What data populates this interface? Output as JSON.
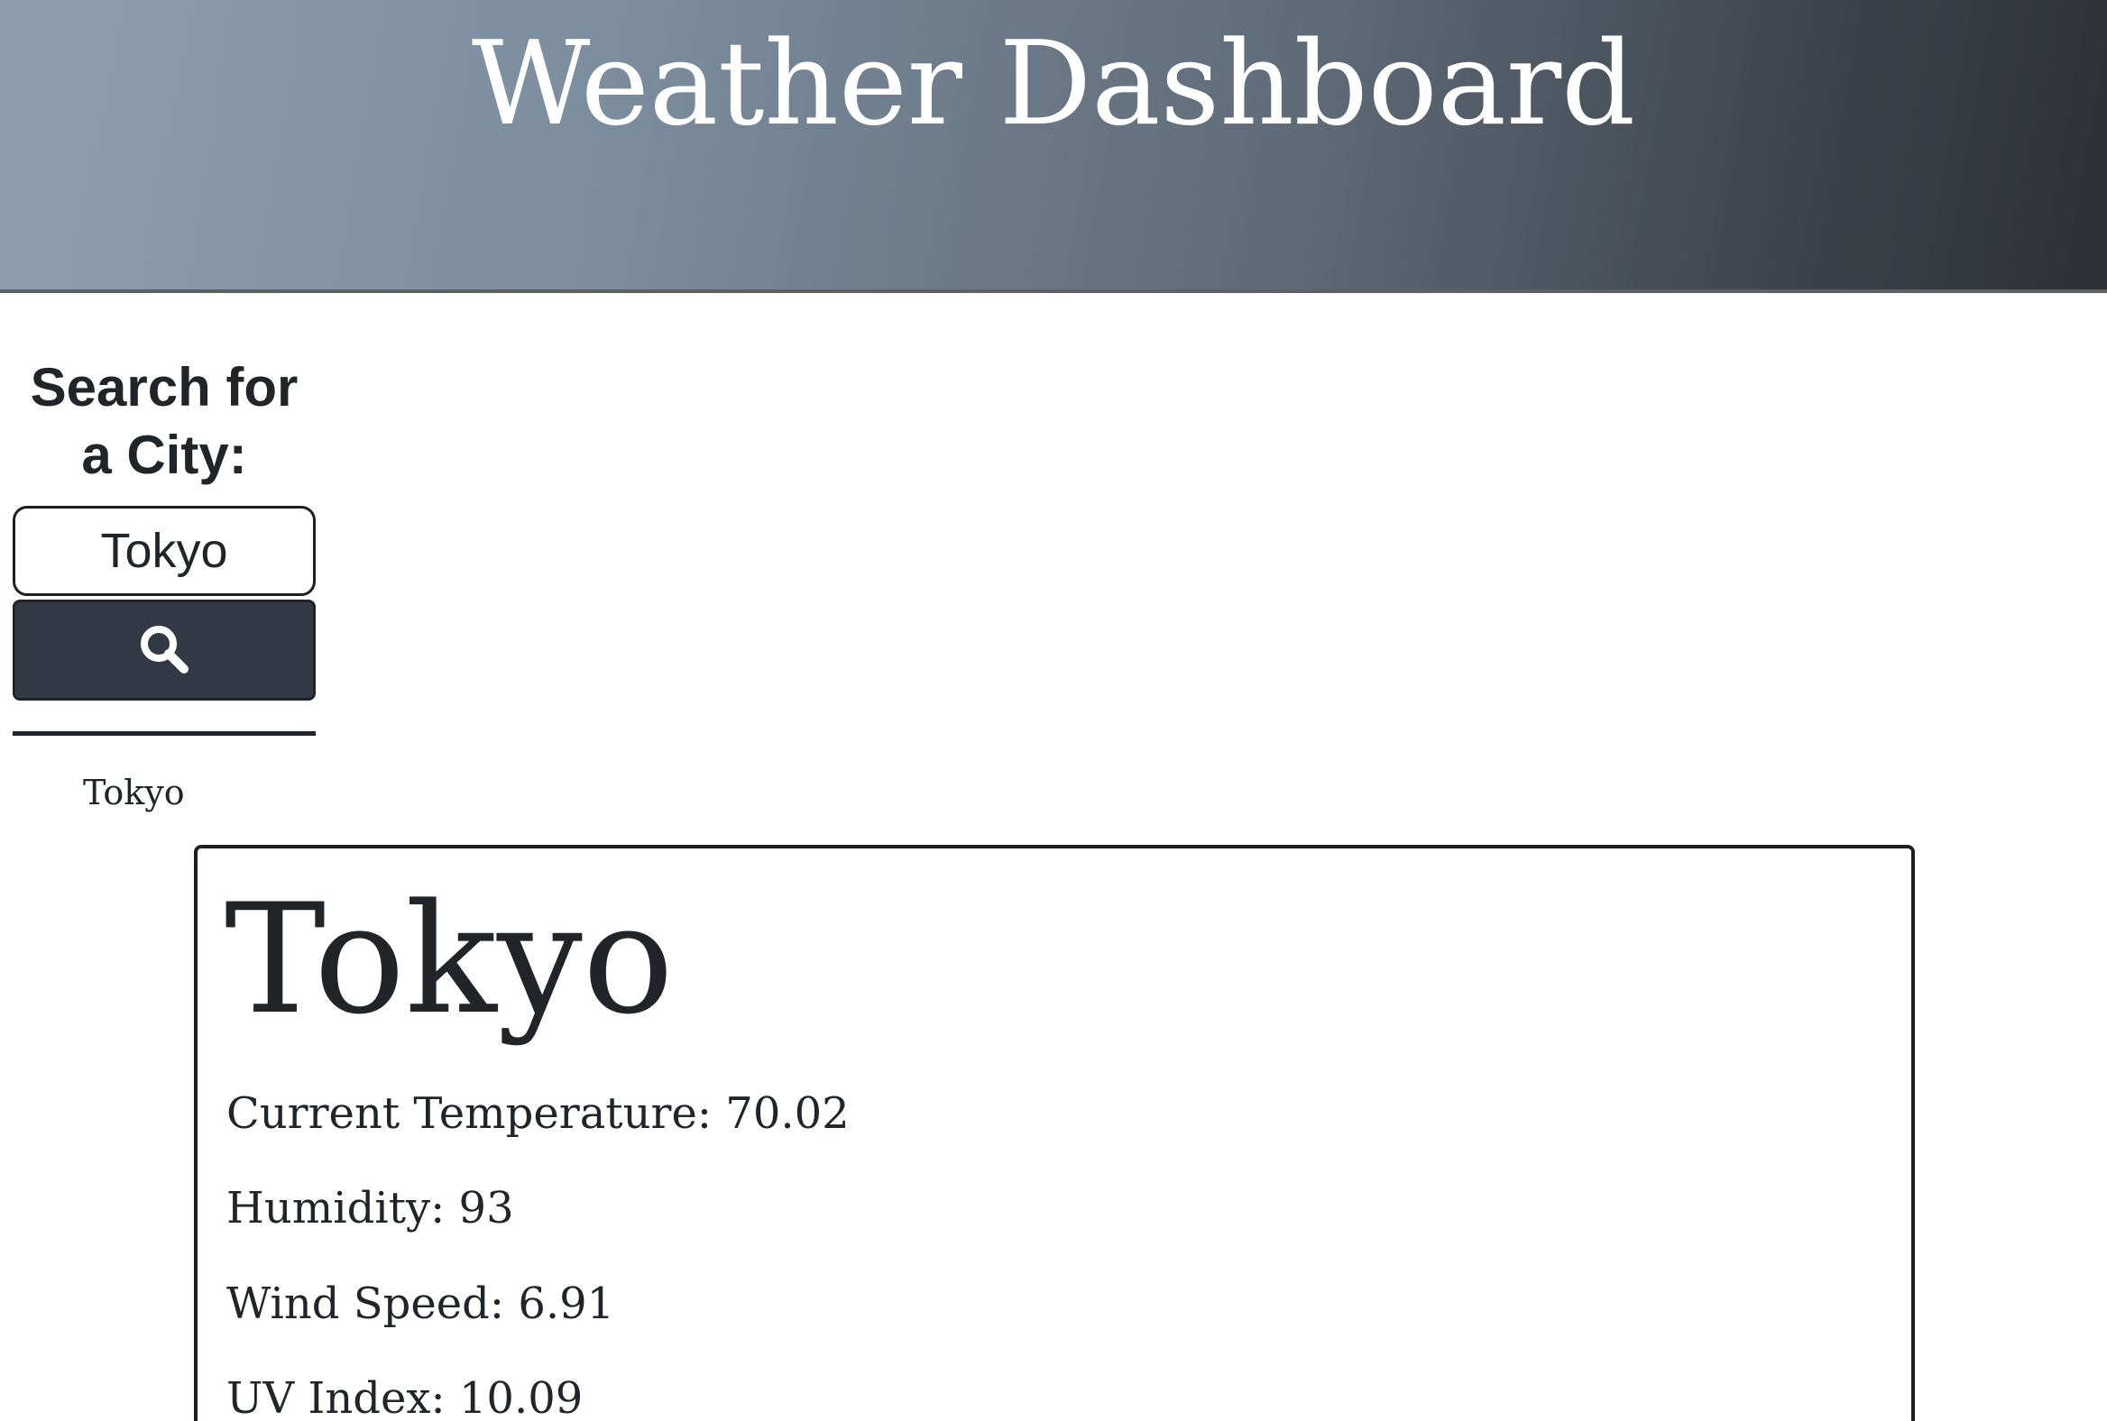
{
  "header": {
    "title": "Weather Dashboard"
  },
  "sidebar": {
    "heading": "Search for a City:",
    "search_input_value": "Tokyo",
    "search_button_icon": "search-icon",
    "history": [
      "Tokyo"
    ]
  },
  "current": {
    "city": "Tokyo",
    "temperature_text": "Current Temperature: 70.02",
    "humidity_text": "Humidity: 93",
    "wind_speed_text": "Wind Speed: 6.91",
    "uv_index_text": "UV Index: 10.09"
  },
  "colors": {
    "header_gradient_start": "#8c9eb0",
    "header_gradient_end": "#2d3036",
    "button_bg": "#343a45",
    "text": "#212529"
  }
}
